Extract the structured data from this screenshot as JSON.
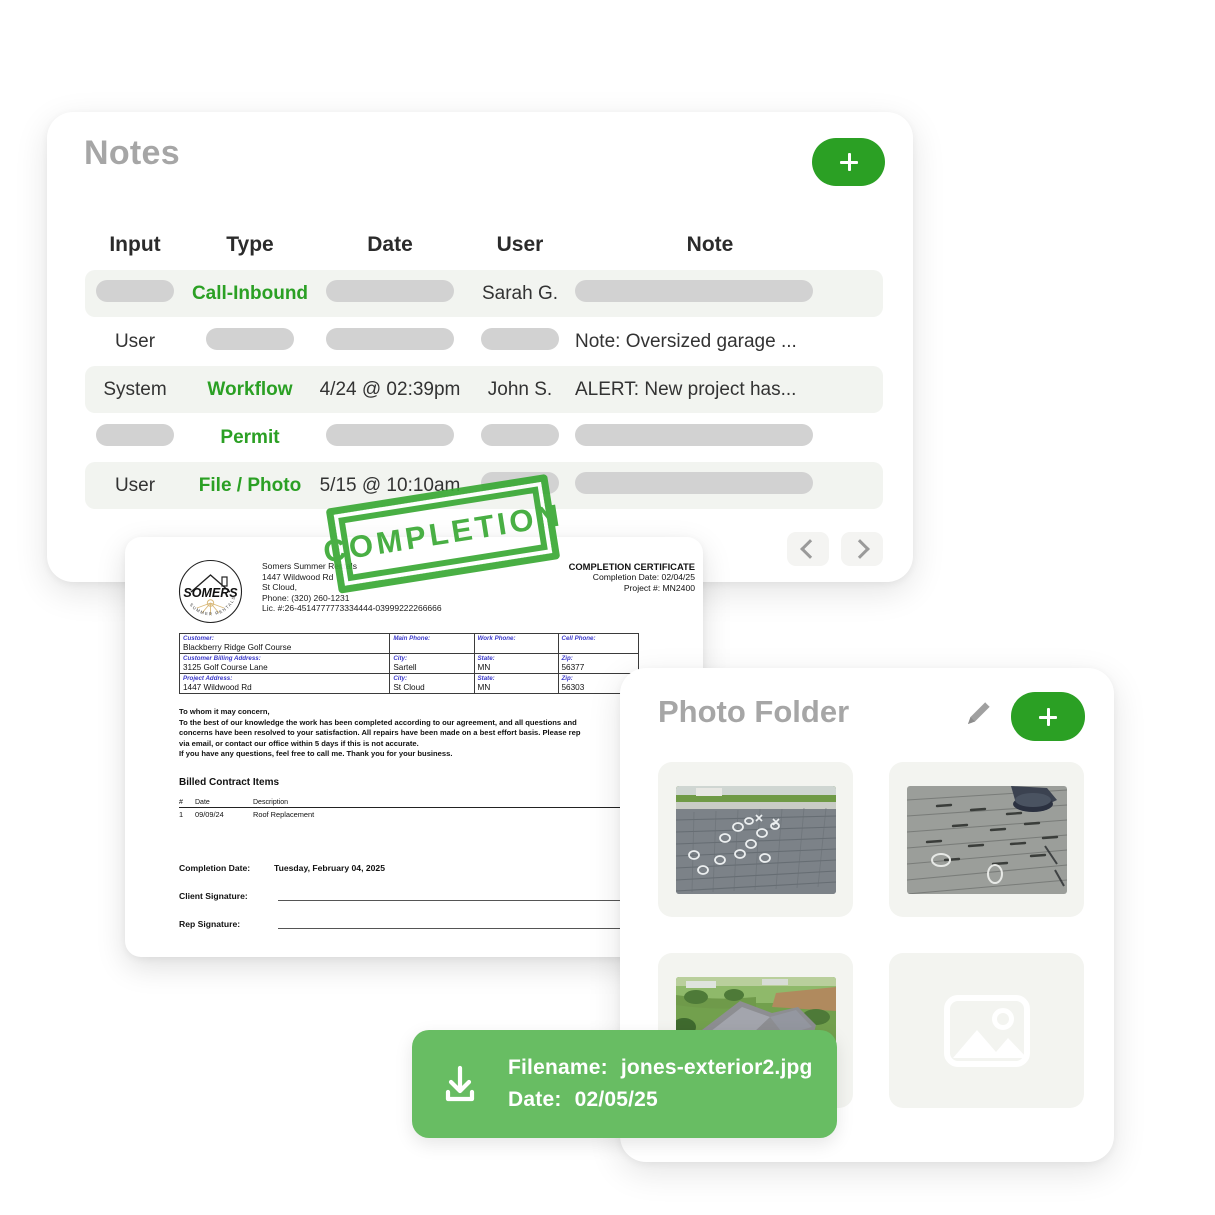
{
  "notes": {
    "title": "Notes",
    "add_label": "+",
    "columns": [
      "Input",
      "Type",
      "Date",
      "User",
      "Note"
    ],
    "rows": [
      {
        "input": "",
        "type": "Call-Inbound",
        "date": "",
        "user": "Sarah G.",
        "note": "",
        "input_masked": true,
        "type_masked": false,
        "date_masked": true,
        "user_masked": false,
        "note_masked": true
      },
      {
        "input": "User",
        "type": "",
        "date": "",
        "user": "",
        "note": "Note: Oversized garage ...",
        "input_masked": false,
        "type_masked": true,
        "date_masked": true,
        "user_masked": true,
        "note_masked": false
      },
      {
        "input": "System",
        "type": "Workflow",
        "date": "4/24 @ 02:39pm",
        "user": "John S.",
        "note": "ALERT: New project has...",
        "input_masked": false,
        "type_masked": false,
        "date_masked": false,
        "user_masked": false,
        "note_masked": false
      },
      {
        "input": "",
        "type": "Permit",
        "date": "",
        "user": "",
        "note": "",
        "input_masked": true,
        "type_masked": false,
        "date_masked": true,
        "user_masked": true,
        "note_masked": true
      },
      {
        "input": "User",
        "type": "File / Photo",
        "date": "5/15 @ 10:10am",
        "user": "",
        "note": "",
        "input_masked": false,
        "type_masked": false,
        "date_masked": false,
        "user_masked": true,
        "note_masked": true
      }
    ],
    "pager": {
      "prev": "chevron-left-icon",
      "next": "chevron-right-icon"
    }
  },
  "document": {
    "stamp": "COMPLETION",
    "logo_text": "SOMERS",
    "company": {
      "name": "Somers Summer Rentals",
      "address": "1447 Wildwood Rd",
      "city": "St Cloud,",
      "phone": "Phone: (320) 260-1231",
      "license": "Lic. #:26-4514777773334444-03999222266666"
    },
    "header": {
      "title": "COMPLETION CERTIFICATE",
      "completion_date": "Completion Date: 02/04/25",
      "project_no": "Project #: MN2400"
    },
    "info_table": {
      "customer_label": "Customer:",
      "customer_value": "Blackberry Ridge Golf Course",
      "main_phone_label": "Main Phone:",
      "main_phone_value": "",
      "work_phone_label": "Work Phone:",
      "work_phone_value": "",
      "cell_phone_label": "Cell Phone:",
      "cell_phone_value": "",
      "billing_label": "Customer Billing Address:",
      "billing_value": "3125 Golf Course Lane",
      "billing_city_label": "City:",
      "billing_city_value": "Sartell",
      "billing_state_label": "State:",
      "billing_state_value": "MN",
      "billing_zip_label": "Zip:",
      "billing_zip_value": "56377",
      "project_label": "Project Address:",
      "project_value": "1447 Wildwood Rd",
      "project_city_label": "City:",
      "project_city_value": "St Cloud",
      "project_state_label": "State:",
      "project_state_value": "MN",
      "project_zip_label": "Zip:",
      "project_zip_value": "56303"
    },
    "body": {
      "salutation": "To whom it may concern,",
      "line1": "To the best of our knowledge the work has been completed according to our agreement, and all questions and",
      "line2": "concerns have been resolved to your satisfaction. All repairs have been made on a best effort basis. Please rep",
      "line3": "via email, or contact our office within 5 days if this is not accurate.",
      "line4": "If you have any questions, feel free to call me. Thank you for your business."
    },
    "items": {
      "heading": "Billed Contract Items",
      "columns": [
        "#",
        "Date",
        "Description"
      ],
      "rows": [
        [
          "1",
          "09/09/24",
          "Roof Replacement"
        ]
      ]
    },
    "signatures": {
      "completion_date_label": "Completion Date:",
      "completion_date_value": "Tuesday, February 04, 2025",
      "client_label": "Client Signature:",
      "rep_label": "Rep Signature:"
    }
  },
  "photo_folder": {
    "title": "Photo Folder",
    "edit_label": "pencil-icon",
    "add_label": "+",
    "cells": [
      {
        "kind": "photo",
        "name": "roof-shingles-marked-1"
      },
      {
        "kind": "photo",
        "name": "roof-shingles-marked-2"
      },
      {
        "kind": "photo",
        "name": "house-exterior-aerial"
      },
      {
        "kind": "placeholder",
        "name": "image-placeholder"
      }
    ]
  },
  "download_banner": {
    "icon": "download-icon",
    "filename_label": "Filename:",
    "filename_value": "jones-exterior2.jpg",
    "date_label": "Date:",
    "date_value": "02/05/25"
  },
  "colors": {
    "green_accent": "#2ba024",
    "banner_green": "#68bd63",
    "stamp_green": "#3aa935",
    "row_alt": "#f2f4f0",
    "pill": "#d2d2d2",
    "title_gray": "#a6a6a6"
  }
}
